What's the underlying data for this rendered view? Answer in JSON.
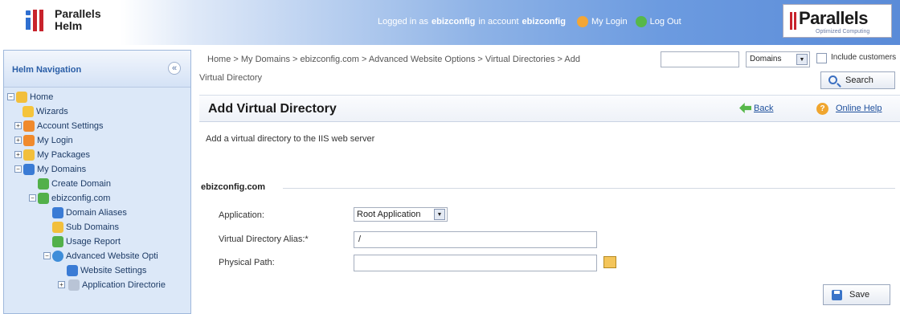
{
  "header": {
    "logo_line1": "Parallels",
    "logo_line2": "Helm",
    "logged_in_as_label": "Logged in as",
    "user": "ebizconfig",
    "in_account_label": "in account",
    "account": "ebizconfig",
    "my_login": "My Login",
    "log_out": "Log Out",
    "brand_name": "Parallels",
    "brand_tagline": "Optimized Computing"
  },
  "sidebar": {
    "title": "Helm Navigation",
    "collapse_glyph": "«",
    "items": [
      {
        "label": "Home",
        "toggle": "−",
        "icon": "home-folder-icon"
      },
      {
        "label": "Wizards",
        "toggle": "",
        "icon": "wizard-icon"
      },
      {
        "label": "Account Settings",
        "toggle": "+",
        "icon": "settings-icon"
      },
      {
        "label": "My Login",
        "toggle": "+",
        "icon": "login-icon"
      },
      {
        "label": "My Packages",
        "toggle": "+",
        "icon": "packages-icon"
      },
      {
        "label": "My Domains",
        "toggle": "−",
        "icon": "domains-icon"
      },
      {
        "label": "Create Domain",
        "toggle": "",
        "icon": "create-domain-icon"
      },
      {
        "label": "ebizconfig.com",
        "toggle": "−",
        "icon": "domain-icon"
      },
      {
        "label": "Domain Aliases",
        "toggle": "",
        "icon": "alias-icon"
      },
      {
        "label": "Sub Domains",
        "toggle": "",
        "icon": "subdomain-icon"
      },
      {
        "label": "Usage Report",
        "toggle": "",
        "icon": "report-icon"
      },
      {
        "label": "Advanced Website Opti",
        "toggle": "−",
        "icon": "globe-icon"
      },
      {
        "label": "Website Settings",
        "toggle": "",
        "icon": "website-settings-icon"
      },
      {
        "label": "Application Directorie",
        "toggle": "+",
        "icon": "folder-icon"
      }
    ]
  },
  "breadcrumb": {
    "line1": "Home > My Domains > ebizconfig.com > Advanced Website Options > Virtual Directories > Add",
    "line2": "Virtual Directory"
  },
  "search": {
    "value": "",
    "scope": "Domains",
    "include_label": "Include customers",
    "button": "Search"
  },
  "page": {
    "title": "Add Virtual Directory",
    "back": "Back",
    "help": "Online Help",
    "description": "Add a virtual directory to the IIS web server"
  },
  "form": {
    "section": "ebizconfig.com",
    "application_label": "Application:",
    "application_value": "Root Application",
    "alias_label": "Virtual Directory Alias:*",
    "alias_value": "/",
    "path_label": "Physical Path:",
    "path_value": "",
    "save": "Save"
  }
}
